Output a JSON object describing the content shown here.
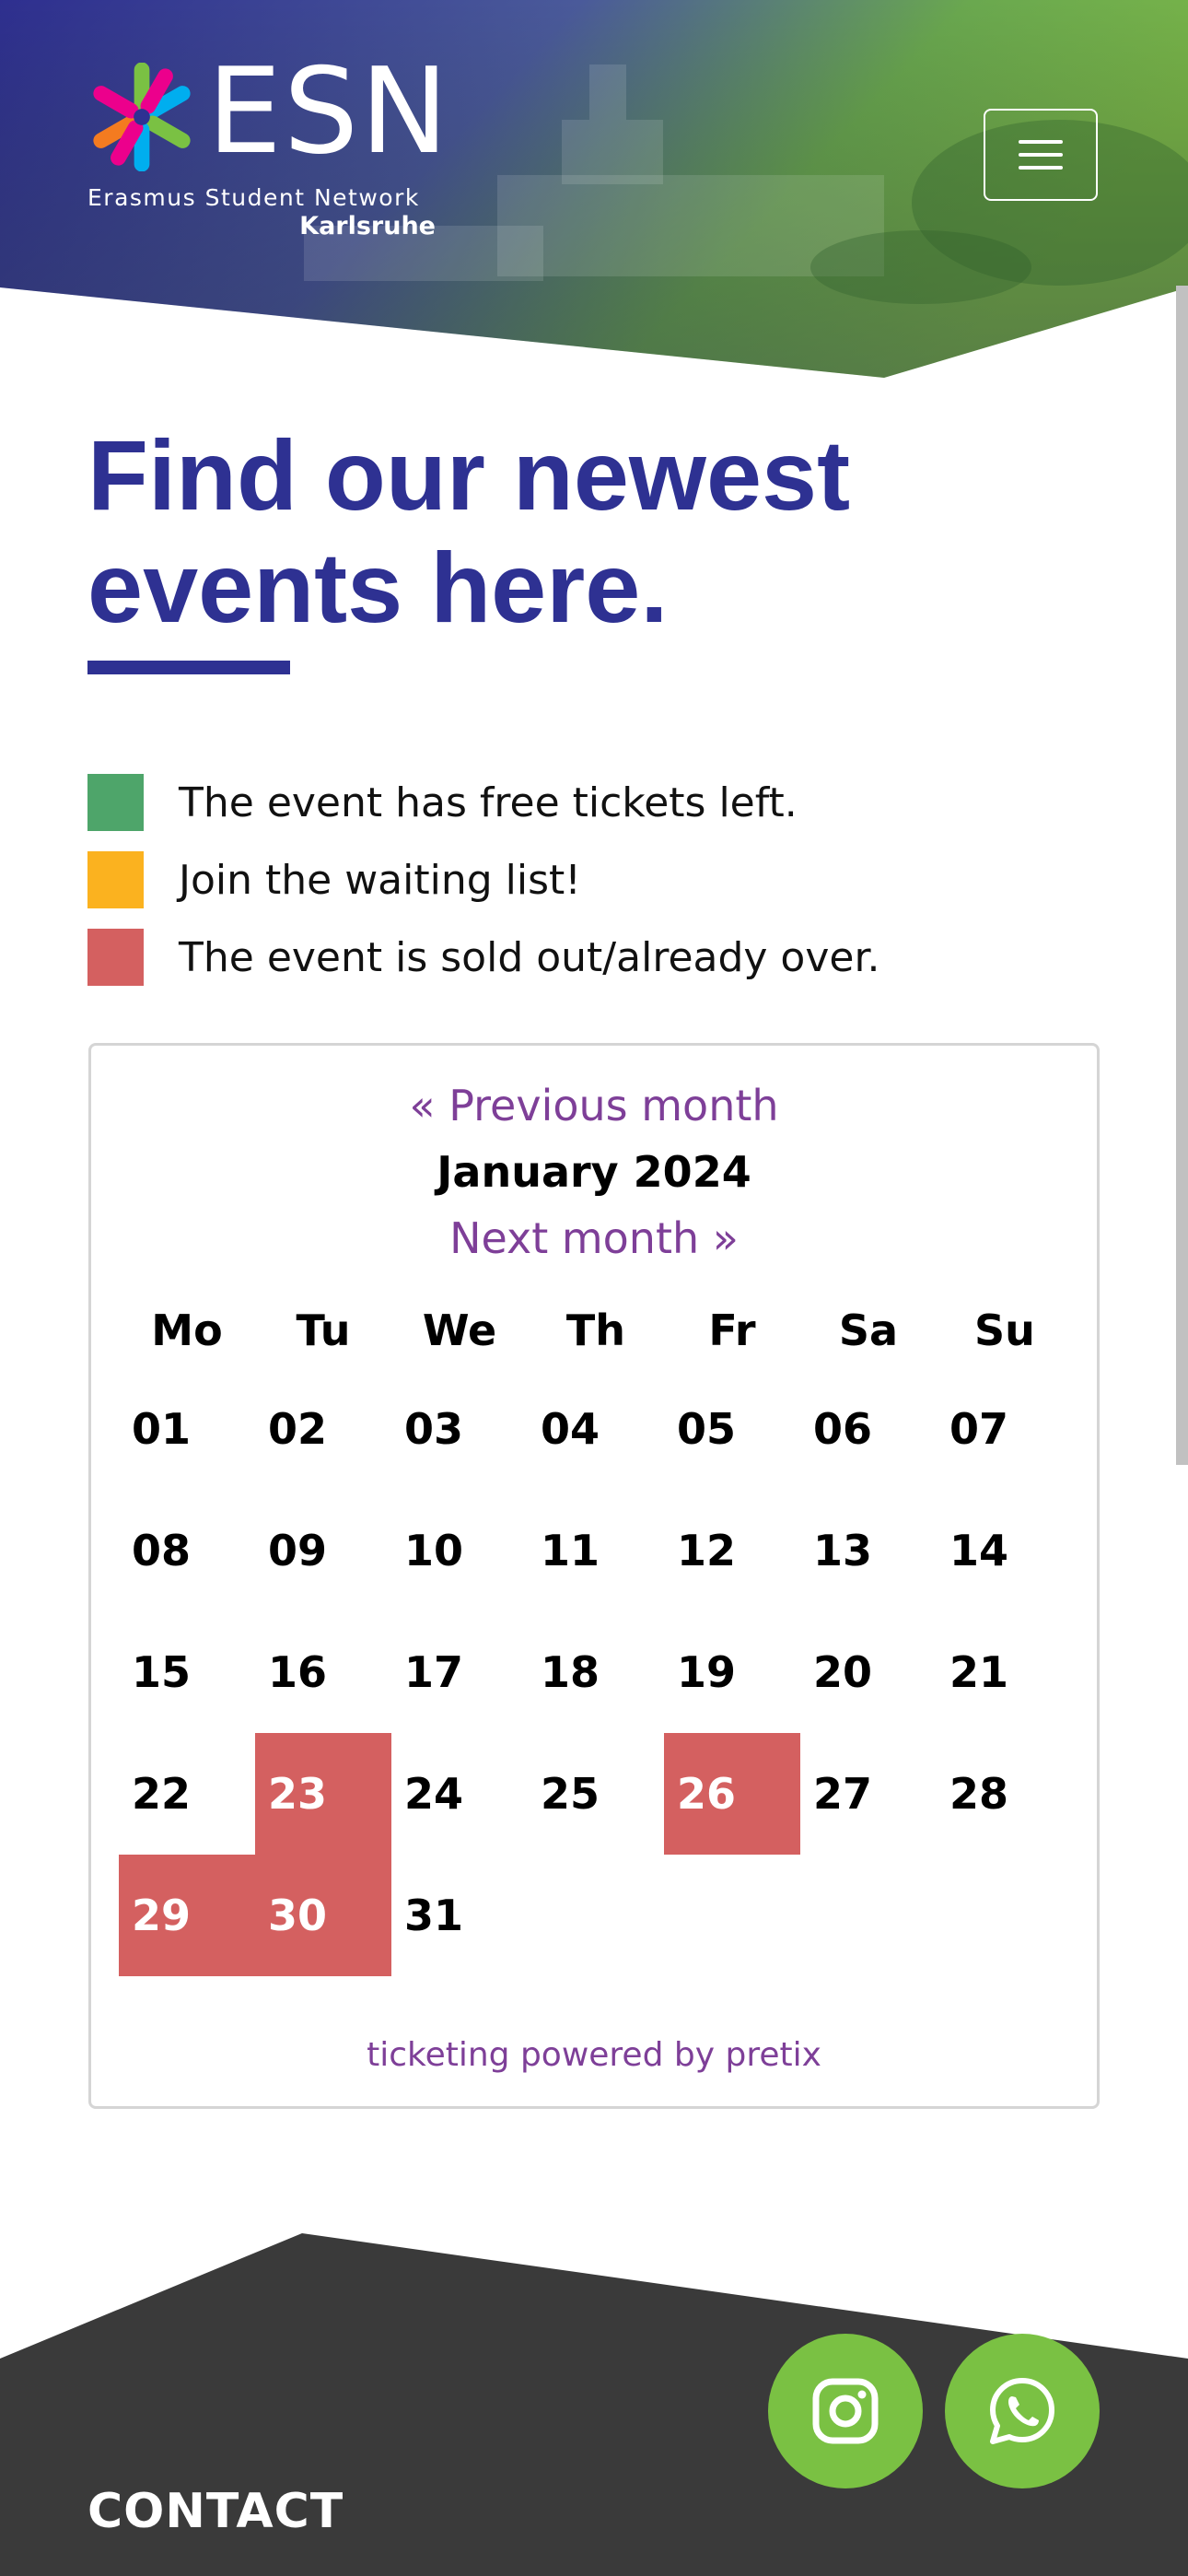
{
  "header": {
    "logo": {
      "name": "ESN",
      "subtitle": "Erasmus Student Network",
      "section": "Karlsruhe"
    },
    "menu_icon": "hamburger-menu-icon"
  },
  "hero": {
    "title_line1": "Find our newest",
    "title_line2": "events here."
  },
  "legend": [
    {
      "color": "#4ea56a",
      "text": "The event has free tickets left."
    },
    {
      "color": "#fbb21f",
      "text": "Join the waiting list!"
    },
    {
      "color": "#d46060",
      "text": "The event is sold out/already over."
    }
  ],
  "calendar": {
    "prev_label": "« Previous month",
    "month_label": "January 2024",
    "next_label": "Next month »",
    "weekdays": [
      "Mo",
      "Tu",
      "We",
      "Th",
      "Fr",
      "Sa",
      "Su"
    ],
    "weeks": [
      [
        "01",
        "02",
        "03",
        "04",
        "05",
        "06",
        "07"
      ],
      [
        "08",
        "09",
        "10",
        "11",
        "12",
        "13",
        "14"
      ],
      [
        "15",
        "16",
        "17",
        "18",
        "19",
        "20",
        "21"
      ],
      [
        "22",
        "23",
        "24",
        "25",
        "26",
        "27",
        "28"
      ],
      [
        "29",
        "30",
        "31",
        "",
        "",
        "",
        ""
      ]
    ],
    "sold_out_days": [
      "23",
      "26",
      "29",
      "30"
    ],
    "powered_by": "ticketing powered by pretix"
  },
  "footer": {
    "contact_label": "CONTACT",
    "social": [
      {
        "icon": "instagram-icon"
      },
      {
        "icon": "whatsapp-icon"
      }
    ],
    "fab_color": "#7ac143"
  },
  "colors": {
    "brand_blue": "#2e3192",
    "link_purple": "#7e3f98",
    "sold_out": "#d46060",
    "footer_bg": "#3a3a3a"
  }
}
